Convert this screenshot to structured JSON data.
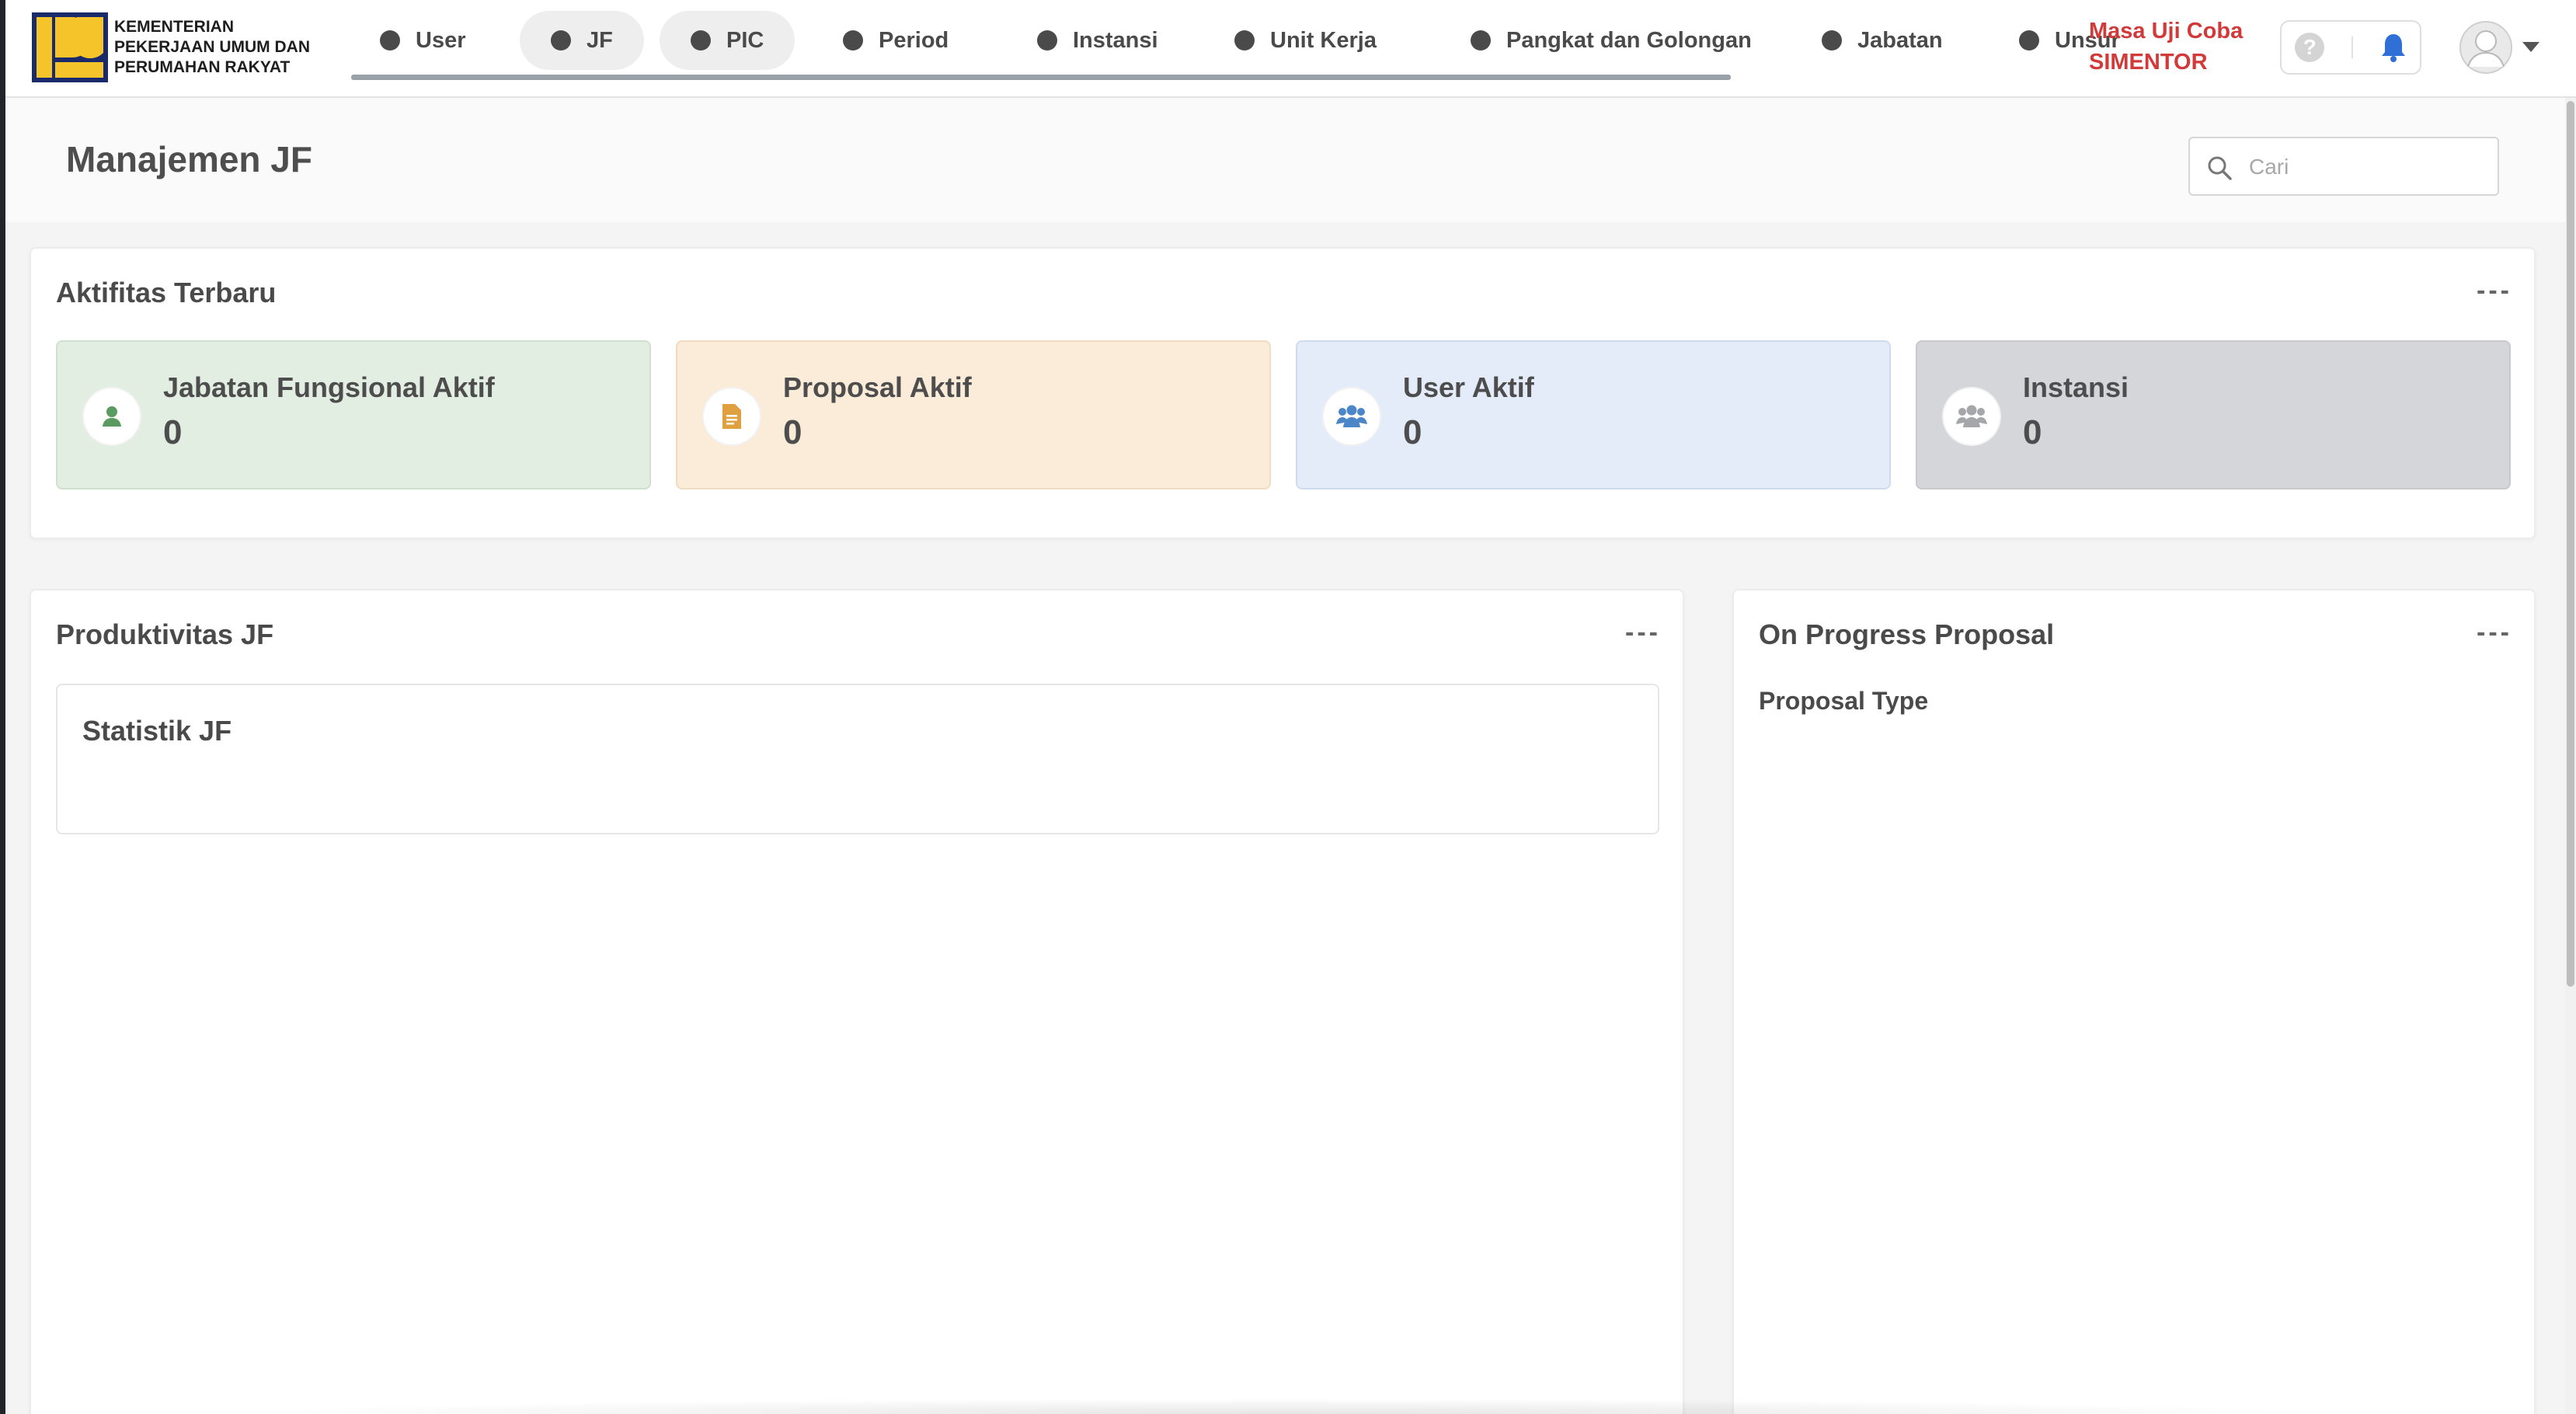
{
  "org": {
    "name_line1": "KEMENTERIAN",
    "name_line2": "PEKERJAAN UMUM DAN",
    "name_line3": "PERUMAHAN RAKYAT"
  },
  "nav": {
    "items": [
      {
        "label": "User",
        "active": false
      },
      {
        "label": "JF",
        "active": true
      },
      {
        "label": "PIC",
        "active": true
      },
      {
        "label": "Period",
        "active": false
      },
      {
        "label": "Instansi",
        "active": false
      },
      {
        "label": "Unit Kerja",
        "active": false
      },
      {
        "label": "Pangkat dan Golongan",
        "active": false
      },
      {
        "label": "Jabatan",
        "active": false
      },
      {
        "label": "Unsur",
        "active": false
      }
    ]
  },
  "trial": {
    "line1": "Masa Uji Coba",
    "line2": "SIMENTOR",
    "color": "#d23a3a"
  },
  "toolbar": {
    "help_icon": "?",
    "help": "help-icon",
    "notif": "bell-icon",
    "notif_color": "#2f6fd6"
  },
  "page": {
    "title": "Manajemen JF"
  },
  "search": {
    "placeholder": "Cari",
    "value": ""
  },
  "activity": {
    "title": "Aktifitas Terbaru",
    "more": "---",
    "stats": [
      {
        "label": "Jabatan Fungsional Aktif",
        "value": "0",
        "icon": "user-icon",
        "bg": "#e3eee3",
        "border": "#cfe0cf",
        "icon_color": "#5b9b62"
      },
      {
        "label": "Proposal Aktif",
        "value": "0",
        "icon": "document-icon",
        "bg": "#fbebd9",
        "border": "#f2dcc1",
        "icon_color": "#e0a040"
      },
      {
        "label": "User Aktif",
        "value": "0",
        "icon": "users-icon",
        "bg": "#e3ecf8",
        "border": "#cfdcf0",
        "icon_color": "#4a86c8"
      },
      {
        "label": "Instansi",
        "value": "0",
        "icon": "group-icon",
        "bg": "#d5d6da",
        "border": "#c8c9cd",
        "icon_color": "#a5a6aa"
      }
    ]
  },
  "productivity": {
    "title": "Produktivitas JF",
    "more": "---",
    "inner_title": "Statistik JF"
  },
  "progress": {
    "title": "On Progress Proposal",
    "more": "---",
    "sub_label": "Proposal Type"
  }
}
